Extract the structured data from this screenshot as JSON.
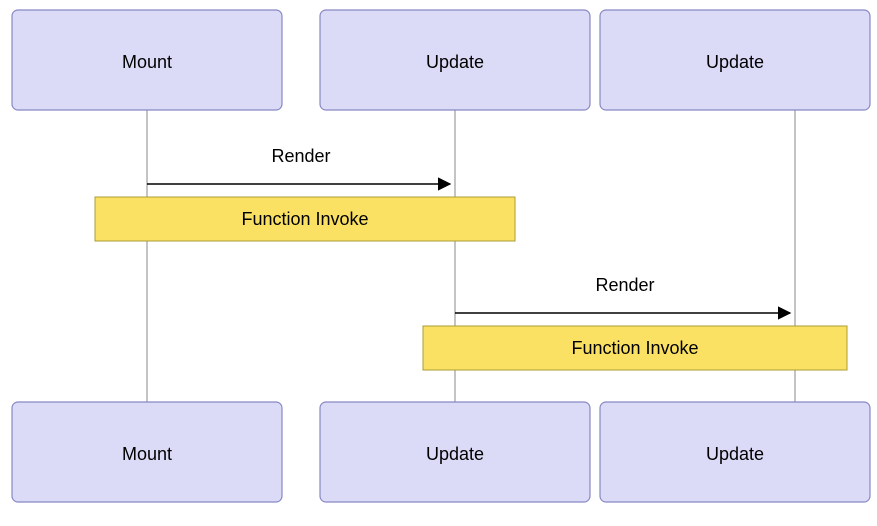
{
  "participants": {
    "p1": {
      "top_label": "Mount",
      "bottom_label": "Mount"
    },
    "p2": {
      "top_label": "Update",
      "bottom_label": "Update"
    },
    "p3": {
      "top_label": "Update",
      "bottom_label": "Update"
    }
  },
  "messages": {
    "m1": {
      "label": "Render"
    },
    "m2": {
      "label": "Render"
    }
  },
  "notes": {
    "n1": {
      "label": "Function Invoke"
    },
    "n2": {
      "label": "Function Invoke"
    }
  },
  "colors": {
    "participant_fill": "#dbdbf8",
    "participant_stroke": "#8888c4",
    "note_fill": "#fae164",
    "note_stroke": "#ad9c33"
  }
}
